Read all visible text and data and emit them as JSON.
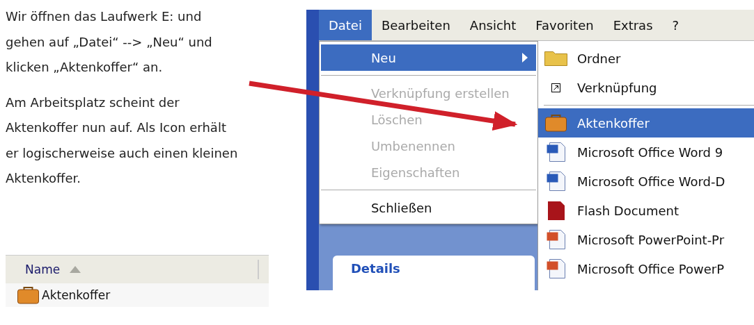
{
  "instructions": [
    "Wir öffnen das Laufwerk E: und gehen auf „Datei“ --> „Neu“ und klicken „Aktenkoffer“ an.",
    "Am Arbeitsplatz scheint der Aktenkoffer nun auf. Als Icon erhält er logischerweise auch einen kleinen Aktenkoffer."
  ],
  "file_list": {
    "column": "Name",
    "rows": [
      {
        "label": "Aktenkoffer",
        "kind": "briefcase"
      }
    ]
  },
  "screenshot": {
    "menubar": [
      {
        "label": "Datei",
        "selected": true
      },
      {
        "label": "Bearbeiten",
        "selected": false
      },
      {
        "label": "Ansicht",
        "selected": false
      },
      {
        "label": "Favoriten",
        "selected": false
      },
      {
        "label": "Extras",
        "selected": false
      },
      {
        "label": "?",
        "selected": false
      }
    ],
    "file_menu": [
      {
        "kind": "submenu",
        "label": "Neu",
        "selected": true,
        "disabled": false
      },
      {
        "kind": "separator"
      },
      {
        "kind": "item",
        "label": "Verknüpfung erstellen",
        "selected": false,
        "disabled": true
      },
      {
        "kind": "item",
        "label": "Löschen",
        "selected": false,
        "disabled": true
      },
      {
        "kind": "item",
        "label": "Umbenennen",
        "selected": false,
        "disabled": true
      },
      {
        "kind": "item",
        "label": "Eigenschaften",
        "selected": false,
        "disabled": true
      },
      {
        "kind": "separator"
      },
      {
        "kind": "item",
        "label": "Schließen",
        "selected": false,
        "disabled": false
      }
    ],
    "new_submenu": [
      {
        "kind": "folder",
        "label": "Ordner",
        "selected": false
      },
      {
        "kind": "shortcut",
        "label": "Verknüpfung",
        "selected": false
      },
      {
        "kind": "separator"
      },
      {
        "kind": "briefcase",
        "label": "Aktenkoffer",
        "selected": true
      },
      {
        "kind": "word",
        "label": "Microsoft Office Word 9",
        "selected": false
      },
      {
        "kind": "word",
        "label": "Microsoft Office Word-D",
        "selected": false
      },
      {
        "kind": "flash",
        "label": "Flash Document",
        "selected": false
      },
      {
        "kind": "powerpoint",
        "label": "Microsoft PowerPoint-Pr",
        "selected": false
      },
      {
        "kind": "powerpoint",
        "label": "Microsoft Office PowerP",
        "selected": false
      }
    ],
    "sidebar": {
      "heading": "Details"
    }
  }
}
